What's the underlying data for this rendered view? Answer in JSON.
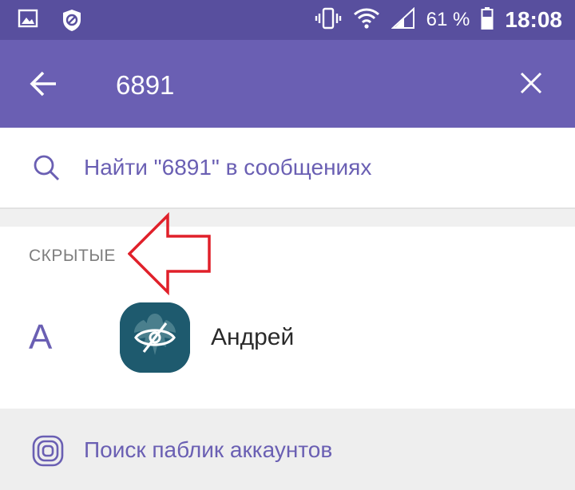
{
  "status_bar": {
    "battery_percent": "61 %",
    "time": "18:08",
    "icons": [
      "gallery-icon",
      "blocked-icon",
      "vibrate-icon",
      "wifi-icon",
      "signal-icon",
      "battery-icon"
    ]
  },
  "toolbar": {
    "search_value": "6891",
    "back_icon": "arrow-left-icon",
    "close_icon": "close-icon"
  },
  "find_in_messages": {
    "label": "Найти \"6891\" в сообщениях",
    "icon": "search-icon"
  },
  "hidden_section": {
    "header": "СКРЫТЫЕ",
    "contact": {
      "index_letter": "А",
      "name": "Андрей",
      "avatar_icon": "hidden-eye-icon"
    }
  },
  "public_accounts": {
    "label": "Поиск паблик аккаунтов",
    "icon": "public-accounts-icon"
  },
  "colors": {
    "status_bar": "#584f9e",
    "toolbar": "#6a5fb3",
    "accent": "#6a5fb3",
    "annotation_arrow": "#e0202a"
  }
}
